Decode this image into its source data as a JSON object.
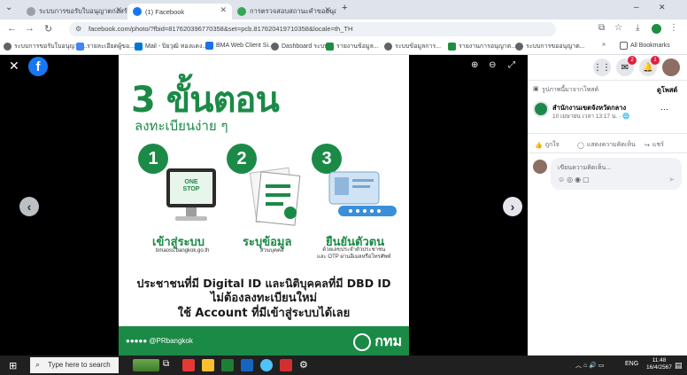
{
  "browser": {
    "tabs": [
      {
        "title": "ระบบการขอรับใบอนุญาตก่อสร้างออนไลน์",
        "active": false
      },
      {
        "title": "(1) Facebook",
        "active": true
      },
      {
        "title": "การตรวจสอบสถานะคำขออนุญาต",
        "active": false
      }
    ],
    "new_tab": "+",
    "window_controls": [
      "–",
      "✕"
    ],
    "url": "facebook.com/photo/?fbid=817620396770358&set=pcb.817620419710358&locale=th_TH",
    "bookmarks": [
      {
        "label": "ระบบการขอรับใบอนุญาต...",
        "color": "#5f6368"
      },
      {
        "label": "รายละเอียดผู้ขอ...",
        "color": "#4285f4"
      },
      {
        "label": "Mail - ปิยวุฒิ ทองแดง...",
        "color": "#0078d4"
      },
      {
        "label": "BMA Web Client Si...",
        "color": "#1a73e8"
      },
      {
        "label": "Dashboard ระบบ...",
        "color": "#5f6368"
      },
      {
        "label": "รายงานข้อมูล...",
        "color": "#1e8e3e"
      },
      {
        "label": "ระบบข้อมูลการ...",
        "color": "#5f6368"
      },
      {
        "label": "รายงานการอนุญาต...",
        "color": "#1e8e3e"
      },
      {
        "label": "ระบบการขออนุญาต...",
        "color": "#5f6368"
      }
    ],
    "bookmarks_more": "»",
    "all_bookmarks": "All Bookmarks"
  },
  "poster": {
    "headline": "3 ขั้นตอน",
    "subheadline": "ลงทะเบียนง่าย ๆ",
    "steps": [
      {
        "num": "1",
        "title": "เข้าสู่ระบบ",
        "desc": "bmaoss.bangkok.go.th"
      },
      {
        "num": "2",
        "title": "ระบุข้อมูล",
        "desc": "ส่วนบุคคล"
      },
      {
        "num": "3",
        "title": "ยืนยันตัวตน",
        "desc": "ด้วยเลขประจำตัวประชาชน\nและ OTP ผ่านอีเมลหรือโทรศัพท์"
      }
    ],
    "onestop": "ONE STOP",
    "message_lines": [
      "ประชาชนที่มี Digital ID และนิติบุคคลที่มี DBD ID",
      "ไม่ต้องลงทะเบียนใหม่",
      "ใช้ Account ที่มีเข้าสู่ระบบได้เลย"
    ],
    "social": "@PRbangkok",
    "logo": "กทม"
  },
  "sidebar": {
    "notif_count": "1",
    "msg_count": "2",
    "album_label": "รูปภาพนี้มาจากโพสต์",
    "album_link": "ดูโพสต์",
    "page_name": "สำนักงานเขตจังหวัดกลาง",
    "post_time": "10 เมษายน เวลา 13:17 น. · 🌐",
    "more": "···",
    "like": "ถูกใจ",
    "comment": "แสดงความคิดเห็น",
    "share": "แชร์",
    "comment_placeholder": "เขียนความคิดเห็น..."
  },
  "taskbar": {
    "search_placeholder": "Type here to search",
    "time": "11:48",
    "date": "16/4/2567",
    "lang": "ENG"
  }
}
